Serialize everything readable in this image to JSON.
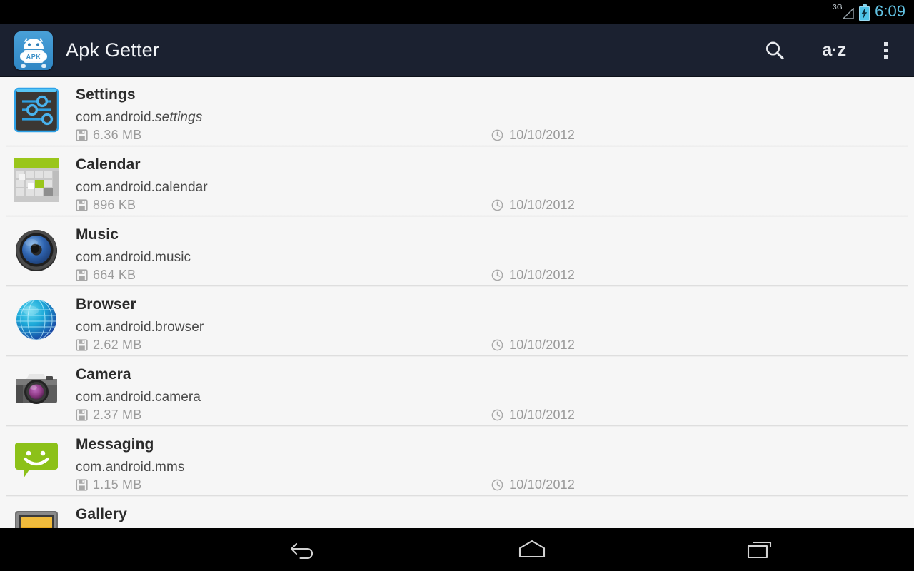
{
  "statusbar": {
    "network_label": "3G",
    "signal_icon": "signal-triangle-icon",
    "battery_icon": "battery-charging-icon",
    "time": "6:09"
  },
  "actionbar": {
    "app_icon": "apk-getter-icon",
    "app_icon_label": "APK",
    "title": "Apk Getter",
    "actions": [
      {
        "name": "search",
        "icon": "search-icon",
        "label": ""
      },
      {
        "name": "sort",
        "icon": "sort-alpha-icon",
        "label": "a·z"
      },
      {
        "name": "overflow",
        "icon": "overflow-menu-icon",
        "label": ""
      }
    ]
  },
  "list": {
    "size_icon": "floppy-save-icon",
    "date_icon": "clock-icon",
    "items": [
      {
        "name": "Settings",
        "package_prefix": "com.android.",
        "package_suffix": "settings",
        "package_suffix_italic": true,
        "size": "6.36 MB",
        "date": "10/10/2012",
        "icon": "settings-sliders-icon"
      },
      {
        "name": "Calendar",
        "package_prefix": "com.android.calendar",
        "package_suffix": "",
        "package_suffix_italic": false,
        "size": "896 KB",
        "date": "10/10/2012",
        "icon": "calendar-grid-icon"
      },
      {
        "name": "Music",
        "package_prefix": "com.android.music",
        "package_suffix": "",
        "package_suffix_italic": false,
        "size": "664 KB",
        "date": "10/10/2012",
        "icon": "music-speaker-icon"
      },
      {
        "name": "Browser",
        "package_prefix": "com.android.browser",
        "package_suffix": "",
        "package_suffix_italic": false,
        "size": "2.62 MB",
        "date": "10/10/2012",
        "icon": "browser-globe-icon"
      },
      {
        "name": "Camera",
        "package_prefix": "com.android.camera",
        "package_suffix": "",
        "package_suffix_italic": false,
        "size": "2.37 MB",
        "date": "10/10/2012",
        "icon": "camera-icon"
      },
      {
        "name": "Messaging",
        "package_prefix": "com.android.mms",
        "package_suffix": "",
        "package_suffix_italic": false,
        "size": "1.15 MB",
        "date": "10/10/2012",
        "icon": "messaging-bubble-icon"
      },
      {
        "name": "Gallery",
        "package_prefix": "",
        "package_suffix": "",
        "package_suffix_italic": false,
        "size": "",
        "date": "",
        "icon": "gallery-photo-icon"
      }
    ]
  },
  "navbar": {
    "buttons": [
      {
        "name": "back",
        "icon": "back-arrow-icon"
      },
      {
        "name": "home",
        "icon": "home-icon"
      },
      {
        "name": "recents",
        "icon": "recents-icon"
      }
    ]
  },
  "colors": {
    "actionbar_bg": "#1b2130",
    "accent_blue": "#3f93d0",
    "list_bg": "#f6f6f6",
    "time_blue": "#62c3e4"
  }
}
